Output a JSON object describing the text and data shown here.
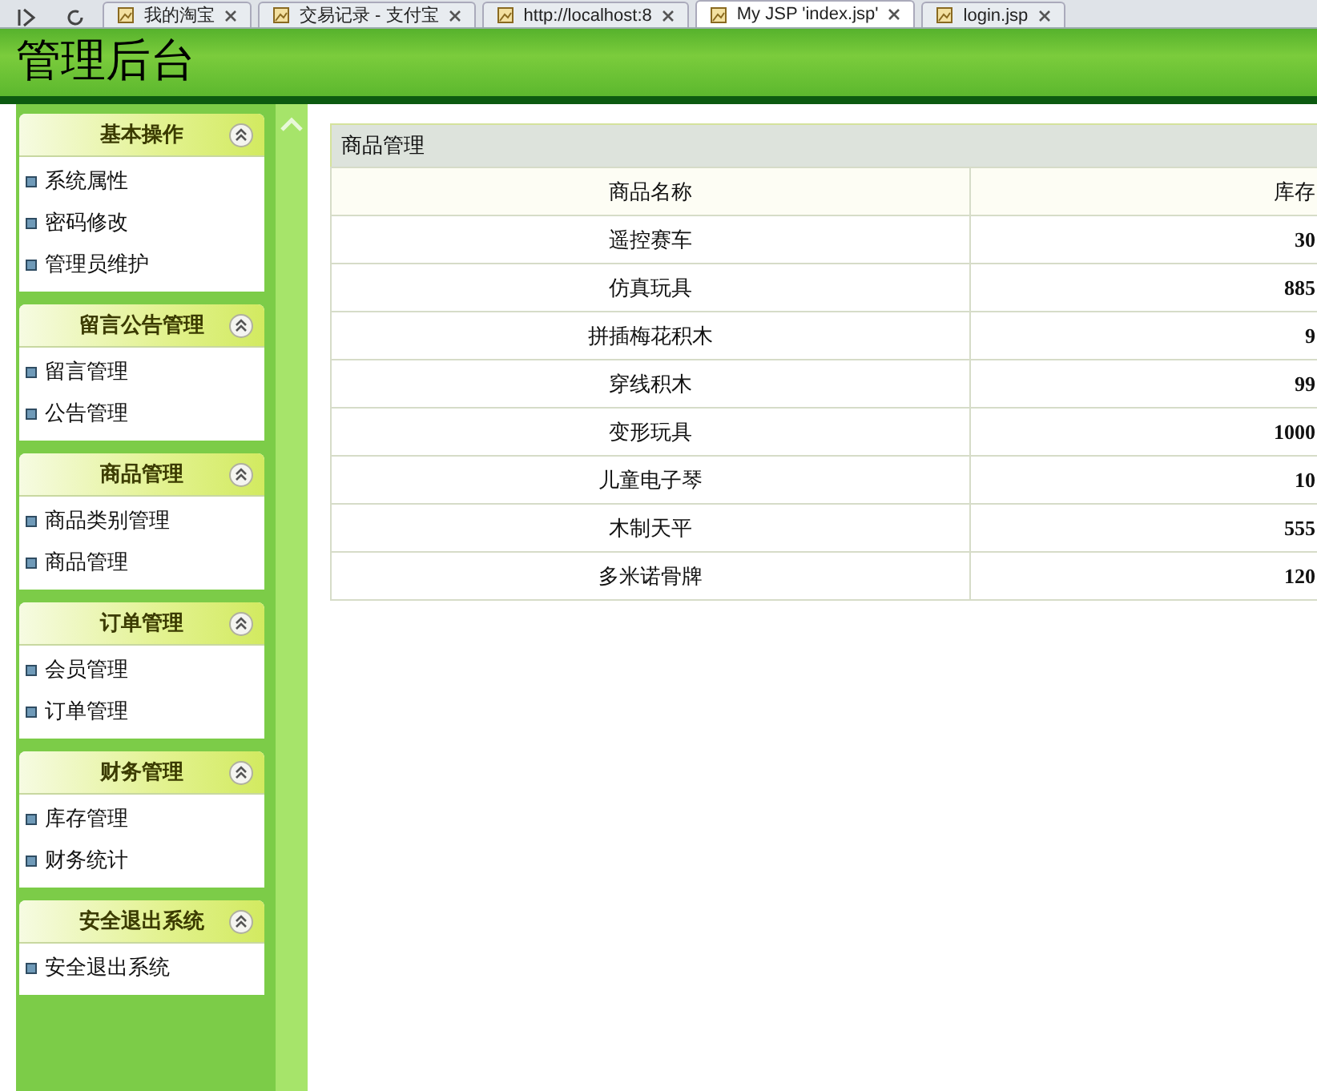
{
  "browser_tabs": [
    {
      "label": "我的淘宝",
      "selected": false
    },
    {
      "label": "交易记录 - 支付宝",
      "selected": false
    },
    {
      "label": "http://localhost:8",
      "selected": false
    },
    {
      "label": "My JSP 'index.jsp'",
      "selected": true
    },
    {
      "label": "login.jsp",
      "selected": false
    }
  ],
  "header": {
    "title": "管理后台"
  },
  "sidebar": {
    "sections": [
      {
        "title": "基本操作",
        "expanded": true,
        "items": [
          "系统属性",
          "密码修改",
          "管理员维护"
        ]
      },
      {
        "title": "留言公告管理",
        "expanded": true,
        "items": [
          "留言管理",
          "公告管理"
        ]
      },
      {
        "title": "商品管理",
        "expanded": true,
        "items": [
          "商品类别管理",
          "商品管理"
        ]
      },
      {
        "title": "订单管理",
        "expanded": true,
        "items": [
          "会员管理",
          "订单管理"
        ]
      },
      {
        "title": "财务管理",
        "expanded": true,
        "items": [
          "库存管理",
          "财务统计"
        ]
      },
      {
        "title": "安全退出系统",
        "expanded": true,
        "items": [
          "安全退出系统"
        ]
      }
    ]
  },
  "panel": {
    "title": "商品管理",
    "table": {
      "columns": [
        "商品名称",
        "库存"
      ],
      "rows": [
        [
          "遥控赛车",
          "30"
        ],
        [
          "仿真玩具",
          "885"
        ],
        [
          "拼插梅花积木",
          "9"
        ],
        [
          "穿线积木",
          "99"
        ],
        [
          "变形玩具",
          "1000"
        ],
        [
          "儿童电子琴",
          "10"
        ],
        [
          "木制天平",
          "555"
        ],
        [
          "多米诺骨牌",
          "120"
        ]
      ]
    }
  }
}
